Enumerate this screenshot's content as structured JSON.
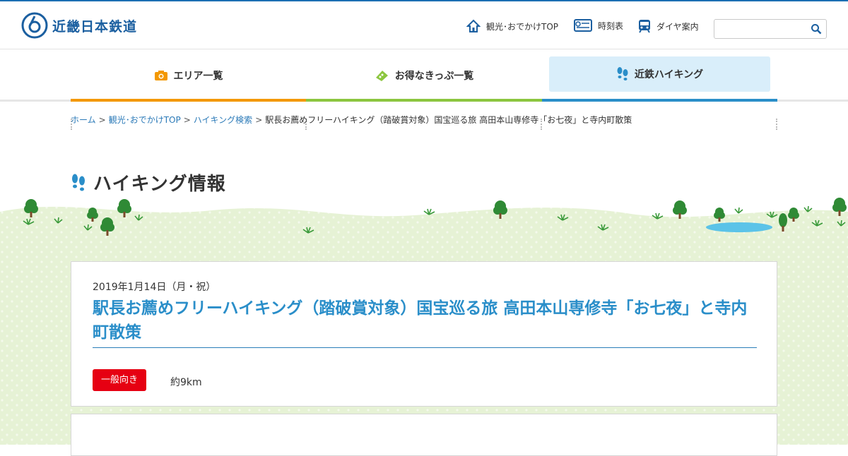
{
  "header": {
    "logo_text": "近畿日本鉄道",
    "links": [
      {
        "label": "観光･おでかけTOP",
        "icon": "house-icon"
      },
      {
        "label": "時刻表",
        "icon": "timetable-icon"
      },
      {
        "label": "ダイヤ案内",
        "icon": "train-icon"
      }
    ],
    "search": {
      "placeholder": "",
      "icon": "search-icon"
    }
  },
  "global_nav": [
    {
      "label": "エリア一覧",
      "icon": "camera-icon",
      "color": "#f39800"
    },
    {
      "label": "お得なきっぷ一覧",
      "icon": "ticket-icon",
      "color": "#8cc63f"
    },
    {
      "label": "近鉄ハイキング",
      "icon": "footprints-icon",
      "color": "#2a8ec9",
      "active": true
    }
  ],
  "breadcrumb": {
    "items": [
      "ホーム",
      "観光･おでかけTOP",
      "ハイキング検索"
    ],
    "current": "駅長お薦めフリーハイキング（踏破賞対象）国宝巡る旅 高田本山専修寺「お七夜」と寺内町散策",
    "separator": ">"
  },
  "page_title": "ハイキング情報",
  "event": {
    "date": "2019年1月14日（月・祝）",
    "title": "駅長お薦めフリーハイキング（踏破賞対象）国宝巡る旅 高田本山専修寺「お七夜」と寺内町散策",
    "level_badge": "一般向き",
    "distance": "約9km"
  },
  "colors": {
    "brand_blue": "#1b5fa0",
    "link_blue": "#2a8ec9",
    "badge_red": "#e60012",
    "grass_green": "#e6f2d5"
  }
}
